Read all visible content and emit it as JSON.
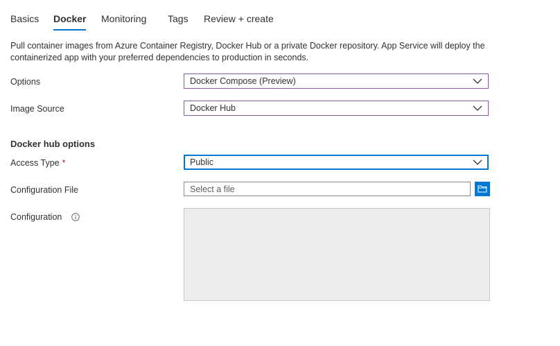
{
  "tabs": [
    {
      "label": "Basics",
      "active": false
    },
    {
      "label": "Docker",
      "active": true
    },
    {
      "label": "Monitoring",
      "active": false
    },
    {
      "label": "Tags",
      "active": false
    },
    {
      "label": "Review + create",
      "active": false
    }
  ],
  "description": "Pull container images from Azure Container Registry, Docker Hub or a private Docker repository. App Service will deploy the containerized app with your preferred dependencies to production in seconds.",
  "form": {
    "options": {
      "label": "Options",
      "value": "Docker Compose (Preview)"
    },
    "image_source": {
      "label": "Image Source",
      "value": "Docker Hub"
    },
    "section_heading": "Docker hub options",
    "access_type": {
      "label": "Access Type",
      "required_mark": "*",
      "value": "Public"
    },
    "configuration_file": {
      "label": "Configuration File",
      "placeholder": "Select a file"
    },
    "configuration": {
      "label": "Configuration"
    }
  },
  "colors": {
    "accent": "#0078d4",
    "dropdown_border": "#8a56a6",
    "required": "#a4262c"
  },
  "icons": [
    "chevron-down-icon",
    "folder-icon",
    "info-icon"
  ]
}
